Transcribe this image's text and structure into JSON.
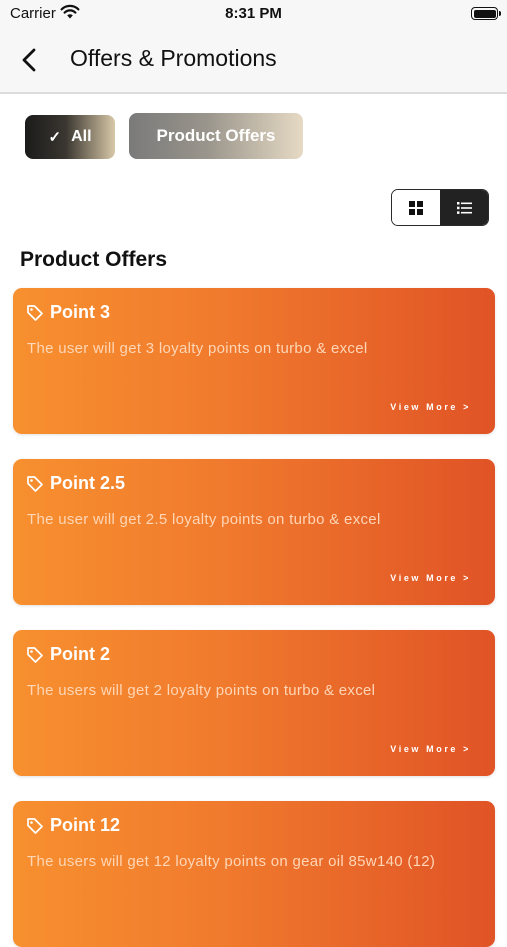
{
  "status_bar": {
    "carrier": "Carrier",
    "time": "8:31 PM"
  },
  "header": {
    "title": "Offers & Promotions"
  },
  "filters": {
    "all_label": "All",
    "product_label": "Product Offers"
  },
  "section": {
    "title": "Product Offers"
  },
  "offers": [
    {
      "title": "Point 3",
      "description": "The user will get 3 loyalty points on turbo & excel",
      "view_more": "View More >"
    },
    {
      "title": "Point 2.5",
      "description": "The user will get 2.5 loyalty points on turbo & excel",
      "view_more": "View More >"
    },
    {
      "title": "Point 2",
      "description": "The users will get 2 loyalty points on turbo & excel",
      "view_more": "View More >"
    },
    {
      "title": "Point 12",
      "description": "The users will get 12 loyalty points on gear oil 85w140 (12)",
      "view_more": ""
    }
  ],
  "colors": {
    "offer_gradient_start": "#f7902f",
    "offer_gradient_end": "#e05326",
    "toggle_active": "#222222"
  }
}
